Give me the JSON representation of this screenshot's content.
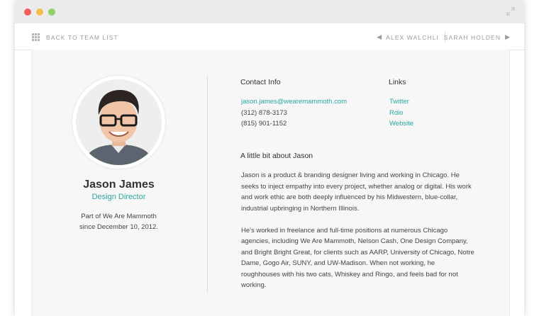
{
  "nav": {
    "back_label": "BACK TO TEAM LIST",
    "prev_label": "ALEX WALCHLI",
    "next_label": "SARAH HOLDEN"
  },
  "profile": {
    "name": "Jason James",
    "role": "Design Director",
    "member_line1": "Part of We Are Mammoth",
    "member_line2": "since December 10, 2012."
  },
  "contact": {
    "heading": "Contact Info",
    "email": "jason.james@wearemammoth.com",
    "phone1": "(312) 878-3173",
    "phone2": "(815) 901-1152"
  },
  "links": {
    "heading": "Links",
    "items": [
      "Twitter",
      "Rdio",
      "Website"
    ]
  },
  "about": {
    "heading": "A little bit about Jason",
    "paragraph1": "Jason is a product & branding designer living and working in Chicago. He seeks to inject empathy into every project, whether analog or digital. His work and work ethic are both deeply influenced by his Midwestern, blue-collar, industrial upbringing in Northern Illinois.",
    "paragraph2": "He's worked in freelance and full-time positions at numerous Chicago agencies, including We Are Mammoth, Nelson Cash, One Design Company, and Bright Bright Great, for clients such as AARP, University of Chicago, Notre Dame, Gogo Air, SUNY, and UW-Madison. When not working, he roughhouses with his two cats, Whiskey and Ringo, and feels bad for not working."
  },
  "colors": {
    "accent": "#2aa6a0",
    "close": "#f25f58",
    "minimize": "#f5be4f",
    "maximize": "#8fd16b"
  }
}
